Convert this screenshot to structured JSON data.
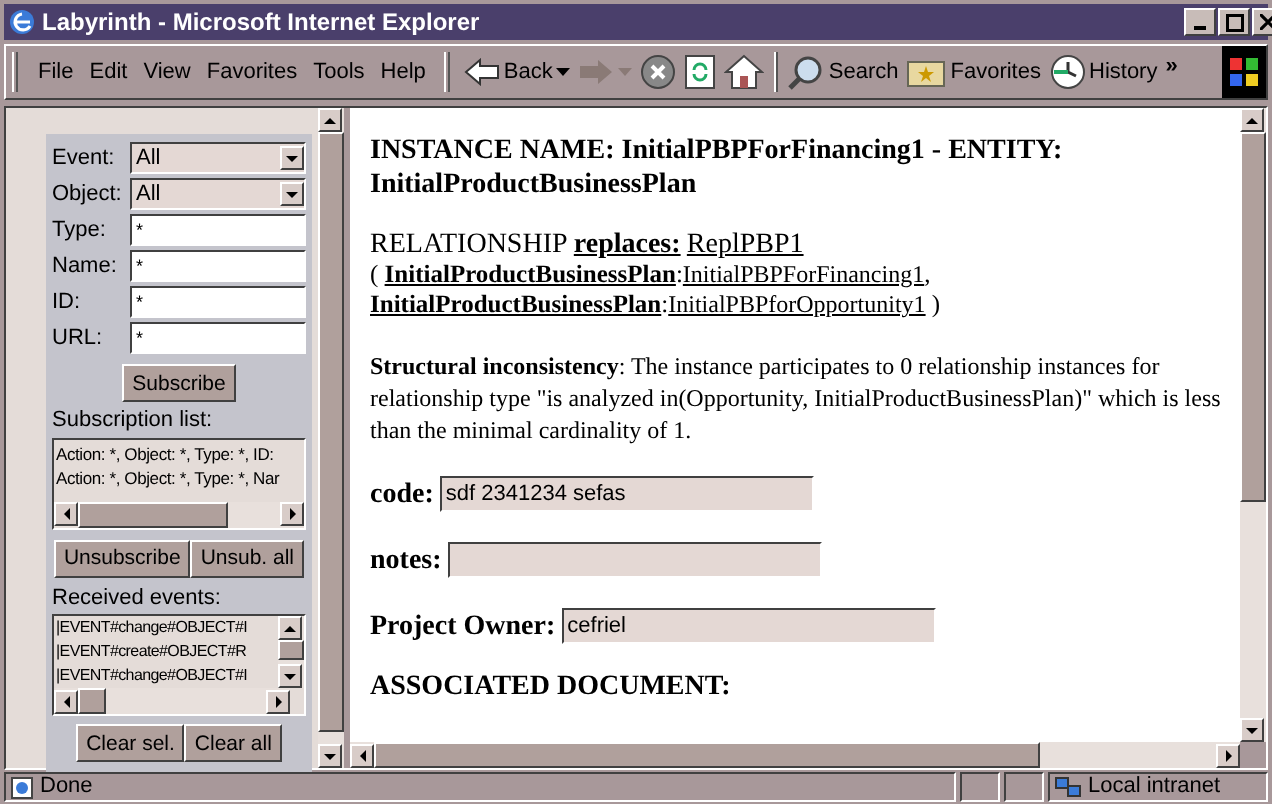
{
  "window": {
    "title": "Labyrinth - Microsoft Internet Explorer"
  },
  "menu": [
    "File",
    "Edit",
    "View",
    "Favorites",
    "Tools",
    "Help"
  ],
  "toolbar": [
    {
      "kind": "back",
      "label": "Back"
    },
    {
      "kind": "forward"
    },
    {
      "kind": "stop"
    },
    {
      "kind": "refresh"
    },
    {
      "kind": "home"
    },
    {
      "kind": "search",
      "label": "Search"
    },
    {
      "kind": "favorites",
      "label": "Favorites"
    },
    {
      "kind": "history",
      "label": "History"
    },
    {
      "kind": "more",
      "label": "»"
    }
  ],
  "filter_panel": {
    "fields": [
      {
        "kind": "select",
        "label": "Event:",
        "value": "All"
      },
      {
        "kind": "select",
        "label": "Object:",
        "value": "All"
      },
      {
        "kind": "text",
        "label": "Type:",
        "value": "*"
      },
      {
        "kind": "text",
        "label": "Name:",
        "value": "*"
      },
      {
        "kind": "text",
        "label": "ID:",
        "value": "*"
      },
      {
        "kind": "text",
        "label": "URL:",
        "value": "*"
      }
    ],
    "subscribe_button": "Subscribe",
    "subscription_label": "Subscription list:",
    "subscriptions": [
      "Action: *, Object: *, Type: *, ID:",
      "Action: *, Object: *, Type: *, Nar"
    ],
    "subscription_buttons": [
      "Unsubscribe",
      "Unsub. all"
    ],
    "events_label": "Received events:",
    "events": [
      "|EVENT#change#OBJECT#I",
      "|EVENT#create#OBJECT#R",
      "|EVENT#change#OBJECT#I"
    ],
    "event_buttons": [
      "Clear sel.",
      "Clear all"
    ]
  },
  "content": {
    "heading": "INSTANCE NAME: InitialPBPForFinancing1 - ENTITY: InitialProductBusinessPlan",
    "relationship": {
      "label": "RELATIONSHIP",
      "role": "replaces:",
      "name": "ReplPBP1",
      "open": "(",
      "members": [
        {
          "entity": "InitialProductBusinessPlan",
          "separator": ":",
          "instance": "InitialPBPForFinancing1",
          "trailing": ","
        },
        {
          "entity": "InitialProductBusinessPlan",
          "separator": ":",
          "instance": "InitialPBPforOpportunity1",
          "trailing": ")"
        }
      ]
    },
    "message": "**Structural inconsistency**: The instance participates to 0 relationship instances for relationship type \"is analyzed in(Opportunity, InitialProductBusinessPlan)\" which is less than the minimal cardinality of 1.",
    "fields": [
      {
        "label": "code:",
        "value": "sdf 2341234 sefas"
      },
      {
        "label": "notes:"
      },
      {
        "label": "Project Owner:",
        "value": "cefriel"
      }
    ],
    "section": "ASSOCIATED DOCUMENT:"
  },
  "status_bar": {
    "text": "Done",
    "zone": "Local intranet"
  }
}
